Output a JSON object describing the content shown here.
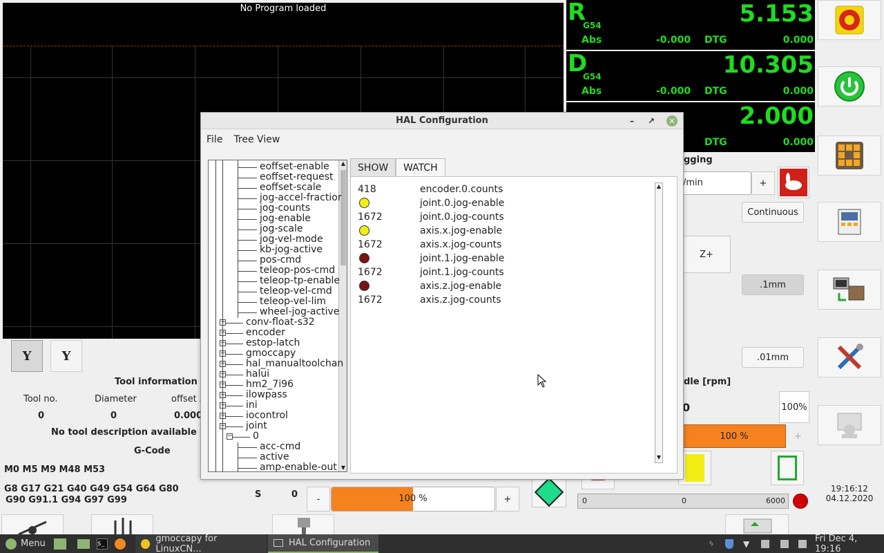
{
  "plot": {
    "title": "No Program loaded"
  },
  "dro": [
    {
      "axis": "R",
      "system": "G54",
      "value": "5.153",
      "abs_label": "Abs",
      "abs_value": "-0.000",
      "dtg_label": "DTG",
      "dtg_value": "0.000"
    },
    {
      "axis": "D",
      "system": "G54",
      "value": "10.305",
      "abs_label": "Abs",
      "abs_value": "-0.000",
      "dtg_label": "DTG",
      "dtg_value": "0.000"
    },
    {
      "axis": "",
      "system": "",
      "value": "2.000",
      "abs_label": "",
      "abs_value": "",
      "dtg_label": "DTG",
      "dtg_value": "0.000"
    }
  ],
  "sidebar": {
    "buttons": [
      "emergency-stop-icon",
      "power-icon",
      "jog-arrows-icon",
      "mdi-icon",
      "auto-run-icon",
      "settings-tools-icon",
      "user-tabs-icon"
    ],
    "mdi_label": "MDI",
    "time": "19:16:12",
    "date": "04.12.2020"
  },
  "jog": {
    "title": "gging",
    "speed_unit": "/min",
    "plus_label": "+",
    "continuous": "Continuous",
    "z_plus": "Z+",
    "inc1": ".1mm",
    "inc2": ".01mm"
  },
  "tool_info": {
    "title": "Tool information",
    "headers": [
      "Tool no.",
      "Diameter",
      "offset z"
    ],
    "values": [
      "0",
      "0",
      "0.000"
    ],
    "description": "No tool description available"
  },
  "gcode": {
    "title": "G-Code",
    "mcodes": "M0 M5 M9 M48 M53",
    "gcodes_line1": "G8 G17 G21 G40 G49 G54 G64 G80",
    "gcodes_line2": "G90 G91.1 G94 G97 G99",
    "s_label": "S",
    "s_value": "0"
  },
  "feed_override": {
    "minus": "-",
    "plus": "+",
    "value": "100 %",
    "fraction": 0.5
  },
  "spindle": {
    "title": "dle [rpm]",
    "zero": "0",
    "percent": "100%",
    "override": "100 %",
    "plus": "+",
    "scale_min": "0",
    "scale_mid": "0",
    "scale_max": "6000"
  },
  "hal_window": {
    "title": "HAL Configuration",
    "menu": [
      "File",
      "Tree View"
    ],
    "tabs": [
      "SHOW",
      "WATCH"
    ],
    "tree": [
      {
        "label": "eoffset-enable",
        "level": 2
      },
      {
        "label": "eoffset-request",
        "level": 2
      },
      {
        "label": "eoffset-scale",
        "level": 2
      },
      {
        "label": "jog-accel-fractior",
        "level": 2
      },
      {
        "label": "jog-counts",
        "level": 2
      },
      {
        "label": "jog-enable",
        "level": 2
      },
      {
        "label": "jog-scale",
        "level": 2
      },
      {
        "label": "jog-vel-mode",
        "level": 2
      },
      {
        "label": "kb-jog-active",
        "level": 2
      },
      {
        "label": "pos-cmd",
        "level": 2
      },
      {
        "label": "teleop-pos-cmd",
        "level": 2
      },
      {
        "label": "teleop-tp-enable",
        "level": 2
      },
      {
        "label": "teleop-vel-cmd",
        "level": 2
      },
      {
        "label": "teleop-vel-lim",
        "level": 2
      },
      {
        "label": "wheel-jog-active",
        "level": 2
      },
      {
        "label": "conv-float-s32",
        "level": 0,
        "expander": "+"
      },
      {
        "label": "encoder",
        "level": 0,
        "expander": "+"
      },
      {
        "label": "estop-latch",
        "level": 0,
        "expander": "+"
      },
      {
        "label": "gmoccapy",
        "level": 0,
        "expander": "+"
      },
      {
        "label": "hal_manualtoolchan",
        "level": 0,
        "expander": "+"
      },
      {
        "label": "halui",
        "level": 0,
        "expander": "+"
      },
      {
        "label": "hm2_7i96",
        "level": 0,
        "expander": "+"
      },
      {
        "label": "ilowpass",
        "level": 0,
        "expander": "+"
      },
      {
        "label": "ini",
        "level": 0,
        "expander": "+"
      },
      {
        "label": "iocontrol",
        "level": 0,
        "expander": "+"
      },
      {
        "label": "joint",
        "level": 0,
        "expander": "-"
      },
      {
        "label": "0",
        "level": 1,
        "expander": "-"
      },
      {
        "label": "acc-cmd",
        "level": 2
      },
      {
        "label": "active",
        "level": 2
      },
      {
        "label": "amp-enable-out",
        "level": 2
      }
    ],
    "watch": [
      {
        "value": "418",
        "name": "encoder.0.counts"
      },
      {
        "led": "#f2ee15",
        "name": "joint.0.jog-enable"
      },
      {
        "value": "1672",
        "name": "joint.0.jog-counts"
      },
      {
        "led": "#f2ee15",
        "name": "axis.x.jog-enable"
      },
      {
        "value": "1672",
        "name": "axis.x.jog-counts"
      },
      {
        "led": "#7a1414",
        "name": "joint.1.jog-enable"
      },
      {
        "value": "1672",
        "name": "joint.1.jog-counts"
      },
      {
        "led": "#7a1414",
        "name": "axis.z.jog-enable"
      },
      {
        "value": "1672",
        "name": "axis.z.jog-counts"
      }
    ]
  },
  "taskbar": {
    "menu": "Menu",
    "tasks": [
      "gmoccapy for LinuxCN...",
      "HAL Configuration"
    ],
    "clock": "Fri Dec 4, 19:16"
  },
  "colors": {
    "dro_green": "#1fdc1f",
    "orange": "#f6821f",
    "led_on": "#f2ee15",
    "led_off": "#7a1414"
  }
}
